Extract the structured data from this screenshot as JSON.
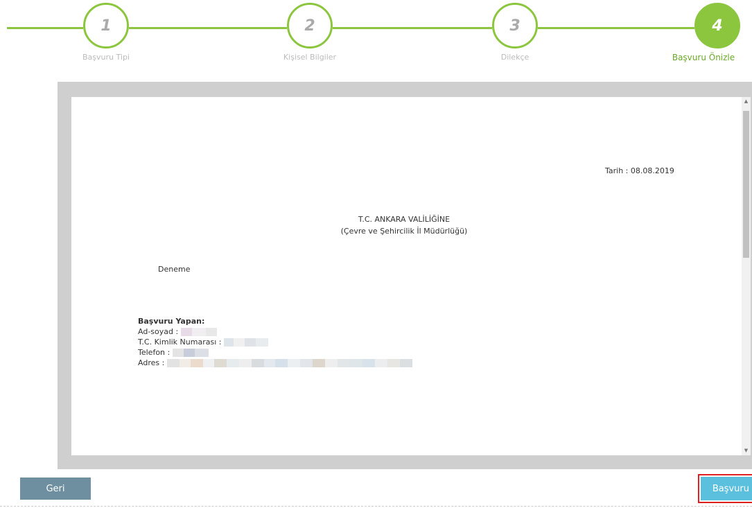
{
  "steps": [
    {
      "number": "1",
      "label": "Başvuru Tipi"
    },
    {
      "number": "2",
      "label": "Kişisel Bilgiler"
    },
    {
      "number": "3",
      "label": "Dilekçe"
    },
    {
      "number": "4",
      "label": "Başvuru Önizle"
    }
  ],
  "document": {
    "date": "Tarih : 08.08.2019",
    "authority_line1": "T.C. ANKARA VALİLİĞİNE",
    "authority_line2": "(Çevre ve Şehircilik İl Müdürlüğü)",
    "body": "Deneme",
    "applicant_heading": "Başvuru Yapan:",
    "name_label": "Ad-soyad :",
    "tc_label": "T.C. Kimlik Numarası :",
    "phone_label": "Telefon :",
    "address_label": "Adres :"
  },
  "buttons": {
    "back": "Geri",
    "submit": "Başvuru"
  },
  "colors": {
    "accent_green": "#8cc63f",
    "back_button": "#6e8fa0",
    "submit_button": "#5bc0de",
    "highlight": "#e02020"
  }
}
